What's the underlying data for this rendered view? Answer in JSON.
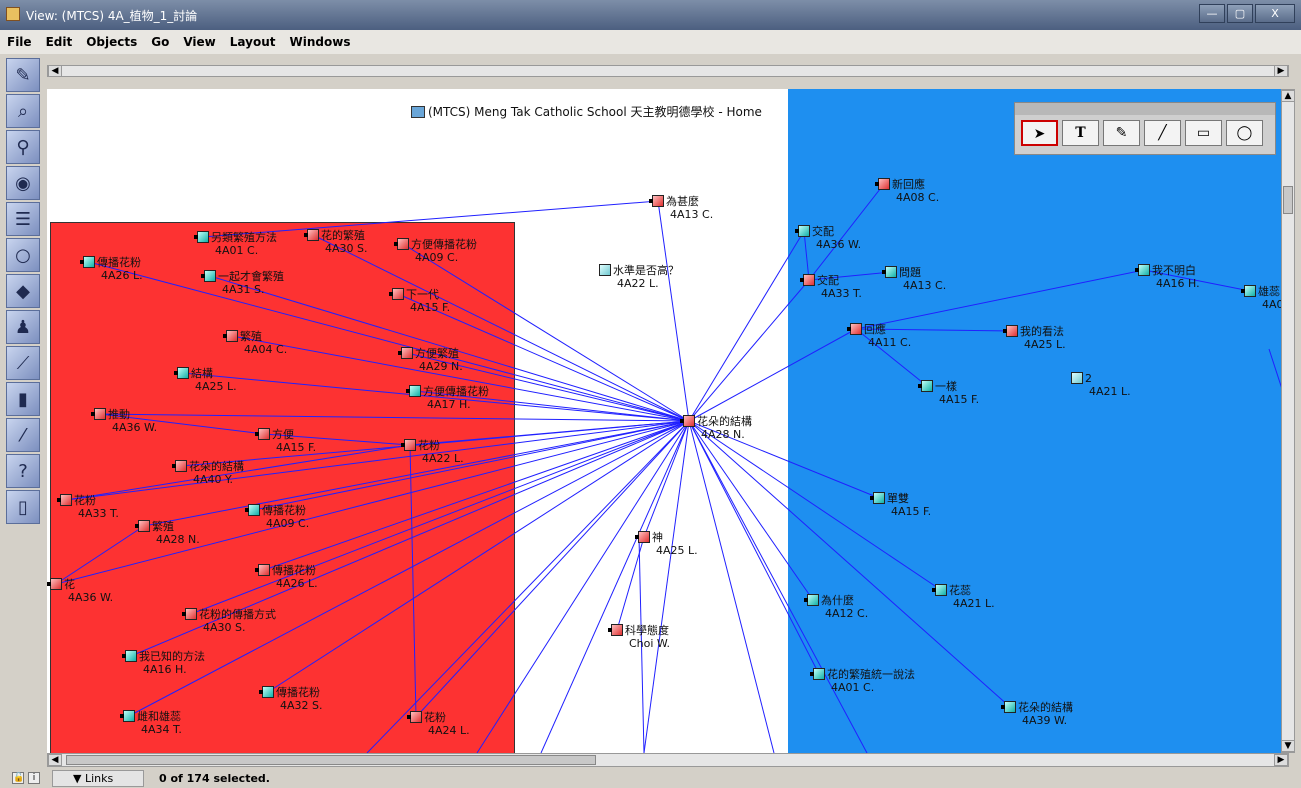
{
  "window": {
    "title": "View: (MTCS) 4A_植物_1_討論",
    "buttons": [
      "—",
      "▢",
      "X"
    ]
  },
  "menu": [
    "File",
    "Edit",
    "Objects",
    "Go",
    "View",
    "Layout",
    "Windows"
  ],
  "toolbox_icons": [
    "pencil-icon",
    "tag-icon",
    "magnifier-icon",
    "camera-icon",
    "list-icon",
    "search-icon",
    "book-icon",
    "people-icon",
    "chart-icon",
    "bar-chart-icon",
    "brush-icon",
    "help-icon",
    "door-icon"
  ],
  "home_link": "(MTCS) Meng Tak Catholic School 天主教明德學校 - Home",
  "drawing_tools": [
    {
      "name": "select-tool",
      "glyph": "➤"
    },
    {
      "name": "text-tool",
      "glyph": "T"
    },
    {
      "name": "brush-tool",
      "glyph": "✎"
    },
    {
      "name": "line-tool",
      "glyph": "╱"
    },
    {
      "name": "rectangle-tool",
      "glyph": "▭"
    },
    {
      "name": "oval-tool",
      "glyph": "◯"
    }
  ],
  "nodes": [
    {
      "id": "n1",
      "label": "為甚麼",
      "author": "4A13 C.",
      "color": "red"
    },
    {
      "id": "n2",
      "label": "另類繁殖方法",
      "author": "4A01 C.",
      "color": "teal"
    },
    {
      "id": "n3",
      "label": "花的繁殖",
      "author": "4A30 S.",
      "color": "red"
    },
    {
      "id": "n4",
      "label": "方便傳播花粉",
      "author": "4A09 C.",
      "color": "red"
    },
    {
      "id": "n5",
      "label": "傳播花粉",
      "author": "4A26 L.",
      "color": "teal"
    },
    {
      "id": "n6",
      "label": "一起才會繁殖",
      "author": "4A31 S.",
      "color": "teal"
    },
    {
      "id": "n7",
      "label": "下一代",
      "author": "4A15 F.",
      "color": "red"
    },
    {
      "id": "n8",
      "label": "水準是否高？",
      "author": "4A22 L.",
      "color": "plain"
    },
    {
      "id": "n9",
      "label": "繁殖",
      "author": "4A04 C.",
      "color": "red"
    },
    {
      "id": "n10",
      "label": "方便繁殖",
      "author": "4A29 N.",
      "color": "red"
    },
    {
      "id": "n11",
      "label": "結構",
      "author": "4A25 L.",
      "color": "teal"
    },
    {
      "id": "n12",
      "label": "方便傳播花粉",
      "author": "4A17 H.",
      "color": "teal"
    },
    {
      "id": "n13",
      "label": "推動",
      "author": "4A36 W.",
      "color": "red"
    },
    {
      "id": "n14",
      "label": "方便",
      "author": "4A15 F.",
      "color": "red"
    },
    {
      "id": "n15",
      "label": "花粉",
      "author": "4A22 L.",
      "color": "red"
    },
    {
      "id": "n16",
      "label": "花朵的結構",
      "author": "4A40 Y.",
      "color": "red"
    },
    {
      "id": "n17",
      "label": "花粉",
      "author": "4A33 T.",
      "color": "red"
    },
    {
      "id": "n18",
      "label": "傳播花粉",
      "author": "4A09 C.",
      "color": "teal"
    },
    {
      "id": "n19",
      "label": "繁殖",
      "author": "4A28 N.",
      "color": "red"
    },
    {
      "id": "n20",
      "label": "花",
      "author": "4A36 W.",
      "color": "red"
    },
    {
      "id": "n21",
      "label": "傳播花粉",
      "author": "4A26 L.",
      "color": "red"
    },
    {
      "id": "n22",
      "label": "花粉的傳播方式",
      "author": "4A30 S.",
      "color": "red"
    },
    {
      "id": "n23",
      "label": "我已知的方法",
      "author": "4A16 H.",
      "color": "teal"
    },
    {
      "id": "n24",
      "label": "傳播花粉",
      "author": "4A32 S.",
      "color": "teal"
    },
    {
      "id": "n25",
      "label": "雌和雄蕊",
      "author": "4A34 T.",
      "color": "teal"
    },
    {
      "id": "n26",
      "label": "花粉",
      "author": "4A24 L.",
      "color": "red"
    },
    {
      "id": "n27",
      "label": "花朵的結構",
      "author": "4A28 N.",
      "color": "red"
    },
    {
      "id": "n28",
      "label": "神",
      "author": "4A25 L.",
      "color": "red"
    },
    {
      "id": "n29",
      "label": "科學態度",
      "author": "Choi W.",
      "color": "red"
    },
    {
      "id": "n30",
      "label": "新回應",
      "author": "4A08 C.",
      "color": "red"
    },
    {
      "id": "n31",
      "label": "交配",
      "author": "4A36 W.",
      "color": "teal"
    },
    {
      "id": "n32",
      "label": "交配",
      "author": "4A33 T.",
      "color": "red"
    },
    {
      "id": "n33",
      "label": "問題",
      "author": "4A13 C.",
      "color": "teal"
    },
    {
      "id": "n34",
      "label": "我不明白",
      "author": "4A16 H.",
      "color": "teal"
    },
    {
      "id": "n35",
      "label": "雄蕊",
      "author": "4A0",
      "color": "teal"
    },
    {
      "id": "n36",
      "label": "回應",
      "author": "4A11 C.",
      "color": "red"
    },
    {
      "id": "n37",
      "label": "我的看法",
      "author": "4A25 L.",
      "color": "red"
    },
    {
      "id": "n38",
      "label": "2",
      "author": "4A21 L.",
      "color": "plain"
    },
    {
      "id": "n39",
      "label": "一樣",
      "author": "4A15 F.",
      "color": "teal"
    },
    {
      "id": "n40",
      "label": "單雙",
      "author": "4A15 F.",
      "color": "teal"
    },
    {
      "id": "n41",
      "label": "花蕊",
      "author": "4A21 L.",
      "color": "teal"
    },
    {
      "id": "n42",
      "label": "為什麼",
      "author": "4A12 C.",
      "color": "teal"
    },
    {
      "id": "n43",
      "label": "花的繁殖統一說法",
      "author": "4A01 C.",
      "color": "teal"
    },
    {
      "id": "n44",
      "label": "花朵的結構",
      "author": "4A39 W.",
      "color": "teal"
    }
  ],
  "status": {
    "links_label": "▼ Links",
    "selection": "0 of 174 selected."
  }
}
